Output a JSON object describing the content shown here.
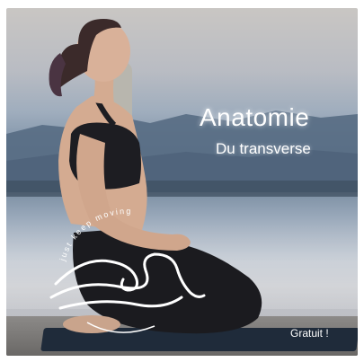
{
  "card": {
    "title": "Anatomie",
    "subtitle": "Du transverse",
    "badge": "Gratuit !"
  },
  "logo": {
    "tagline": "just keep moving"
  },
  "colors": {
    "sky": "#c9c6c3",
    "lake": "#7e92a8",
    "mat": "#1f2b3a",
    "text": "#ffffff"
  }
}
